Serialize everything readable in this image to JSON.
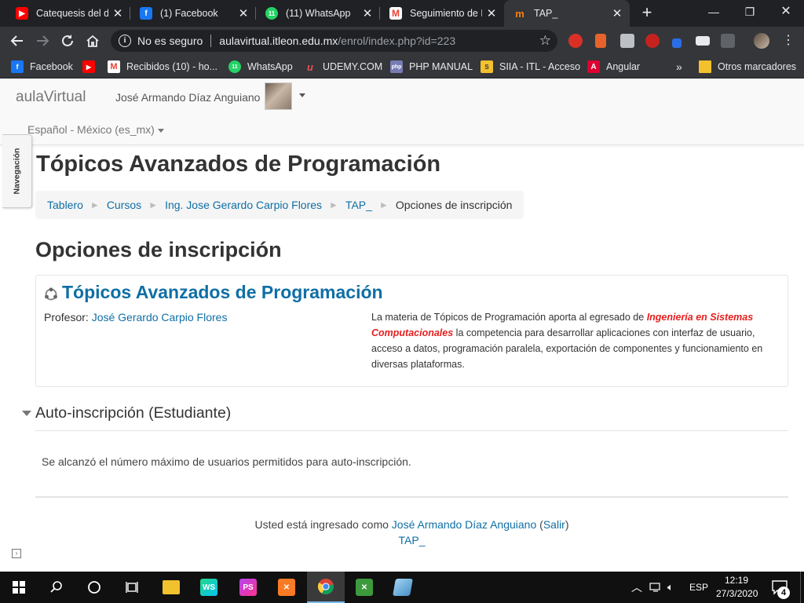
{
  "browser": {
    "tabs": [
      {
        "title": "Catequesis del de",
        "favicon": "youtube-icon",
        "color": "#ff0000"
      },
      {
        "title": "(1) Facebook",
        "favicon": "facebook-icon",
        "color": "#1877f2"
      },
      {
        "title": "(11) WhatsApp",
        "favicon": "whatsapp-icon",
        "color": "#25d366"
      },
      {
        "title": "Seguimiento de R",
        "favicon": "gmail-icon",
        "color": "#ea4335"
      },
      {
        "title": "TAP_",
        "favicon": "moodle-icon",
        "color": "#f98012"
      }
    ],
    "active_tab": 4,
    "omnibox": {
      "security": "No es seguro",
      "host": "aulavirtual.itleon.edu.mx",
      "path": "/enrol/index.php?id=223"
    },
    "bookmarks": [
      {
        "label": "Facebook",
        "icon": "facebook-icon",
        "color": "#1877f2"
      },
      {
        "label": "",
        "icon": "youtube-icon",
        "color": "#ff0000"
      },
      {
        "label": "Recibidos (10) - ho...",
        "icon": "gmail-icon",
        "color": "#ea4335"
      },
      {
        "label": "WhatsApp",
        "icon": "whatsapp-icon",
        "color": "#25d366"
      },
      {
        "label": "UDEMY.COM",
        "icon": "udemy-icon",
        "color": "#ec5252"
      },
      {
        "label": "PHP MANUAL",
        "icon": "php-icon",
        "color": "#777bb3"
      },
      {
        "label": "SIIA - ITL - Acceso",
        "icon": "siia-icon",
        "color": "#f2c12e"
      },
      {
        "label": "Angular",
        "icon": "angular-icon",
        "color": "#dd0031"
      }
    ],
    "bookmarks_overflow": "»",
    "other_bookmarks": "Otros marcadores"
  },
  "moodle": {
    "brand": "aulaVirtual",
    "user_name": "José Armando Díaz Anguiano",
    "language": "Español - México (es_mx)",
    "nav_drawer_label": "Navegación",
    "course_title": "Tópicos Avanzados de Programación",
    "breadcrumb": [
      {
        "label": "Tablero"
      },
      {
        "label": "Cursos"
      },
      {
        "label": "Ing. Jose Gerardo Carpio Flores"
      },
      {
        "label": "TAP_"
      }
    ],
    "breadcrumb_current": "Opciones de inscripción",
    "breadcrumb_divider": "►",
    "section_title": "Opciones de inscripción",
    "coursebox": {
      "title": "Tópicos Avanzados de Programación",
      "teacher_label": "Profesor: ",
      "teacher_name": "José Gerardo Carpio Flores",
      "summary_pre": "La materia de Tópicos de Programación aporta al egresado de ",
      "summary_highlight": "Ingeniería en Sistemas Computacionales",
      "summary_post": " la competencia para desarrollar aplicaciones con interfaz de usuario, acceso a datos, programación paralela, exportación de componentes y funcionamiento en diversas plataformas."
    },
    "enrol": {
      "title": "Auto-inscripción (Estudiante)",
      "message": "Se alcanzó el número máximo de usuarios permitidos para auto-inscripción."
    },
    "footer": {
      "logged_in_text": "Usted está ingresado como ",
      "user_link": "José Armando Díaz Anguiano",
      "logout_open": " (",
      "logout": "Salir",
      "logout_close": ")",
      "course_link": "TAP_"
    },
    "colors": {
      "link": "#0f6fa5",
      "highlight": "#e61e1e"
    }
  },
  "taskbar": {
    "items": [
      {
        "icon": "start-icon"
      },
      {
        "icon": "search-icon"
      },
      {
        "icon": "cortana-icon"
      },
      {
        "icon": "task-view-icon"
      },
      {
        "icon": "file-explorer-icon"
      },
      {
        "icon": "webstorm-icon",
        "text": "WS"
      },
      {
        "icon": "phpstorm-icon",
        "text": "PS"
      },
      {
        "icon": "xampp-icon"
      },
      {
        "icon": "chrome-icon"
      },
      {
        "icon": "app-icon"
      },
      {
        "icon": "app-icon-2"
      }
    ],
    "language": "ESP",
    "time": "12:19",
    "date": "27/3/2020",
    "notifications": "4"
  }
}
